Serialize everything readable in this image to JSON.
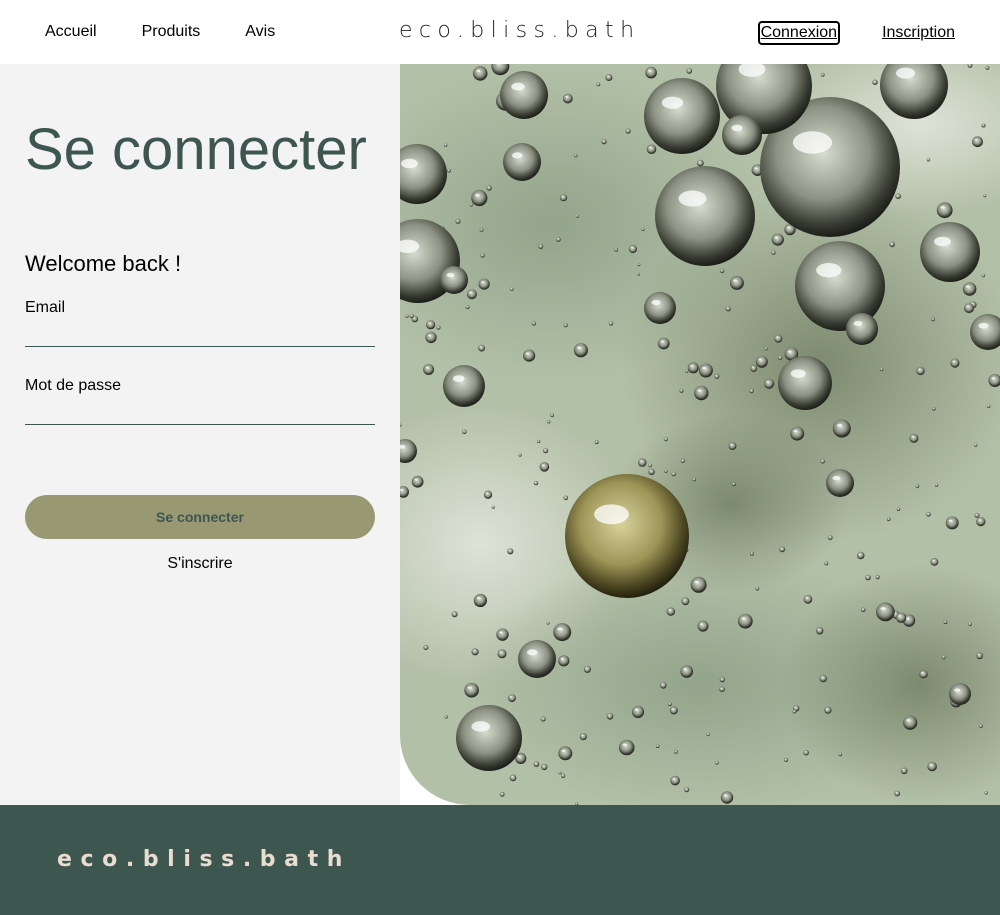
{
  "header": {
    "nav": [
      {
        "label": "Accueil"
      },
      {
        "label": "Produits"
      },
      {
        "label": "Avis"
      }
    ],
    "logo": "eco.bliss.bath",
    "login_label": "Connexion",
    "register_label": "Inscription"
  },
  "login": {
    "title": "Se connecter",
    "subtitle": "Welcome back !",
    "email_label": "Email",
    "email_value": "",
    "password_label": "Mot de passe",
    "password_value": "",
    "submit_label": "Se connecter",
    "signup_link": "S'inscrire"
  },
  "hero": {
    "image_subject": "water-bubbles-on-green-background"
  },
  "footer": {
    "logo": "eco.bliss.bath"
  },
  "colors": {
    "brand_dark_green": "#3e5650",
    "button_olive": "#989873",
    "panel_background": "#f3f3f3",
    "footer_text": "#e9ddd0"
  }
}
